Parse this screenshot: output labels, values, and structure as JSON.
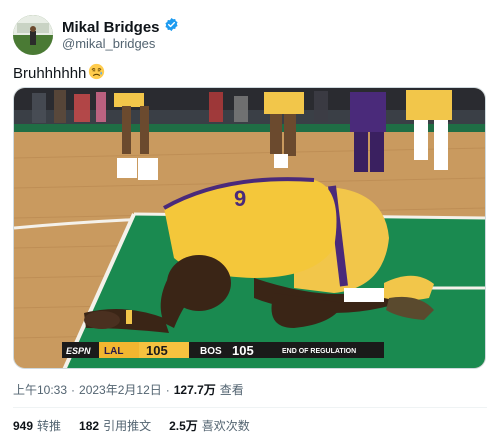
{
  "author": {
    "display_name": "Mikal Bridges",
    "handle": "@mikal_bridges",
    "verified": true,
    "verified_color": "#1d9bf0"
  },
  "tweet": {
    "text": "Bruhhhhhh",
    "emoji": "weary-face-emoji"
  },
  "scoreboard": {
    "network": "ESPN",
    "team1": "LAL",
    "score1": "105",
    "team2": "BOS",
    "score2": "105",
    "status": "END OF REGULATION",
    "team1_color": "#f2b630"
  },
  "jersey_number": "9",
  "meta": {
    "time": "上午10:33",
    "sep1": "·",
    "date": "2023年2月12日",
    "sep2": "·",
    "views_count": "127.7万",
    "views_label": "查看"
  },
  "stats": {
    "retweets_count": "949",
    "retweets_label": "转推",
    "quotes_count": "182",
    "quotes_label": "引用推文",
    "likes_count": "2.5万",
    "likes_label": "喜欢次数"
  }
}
